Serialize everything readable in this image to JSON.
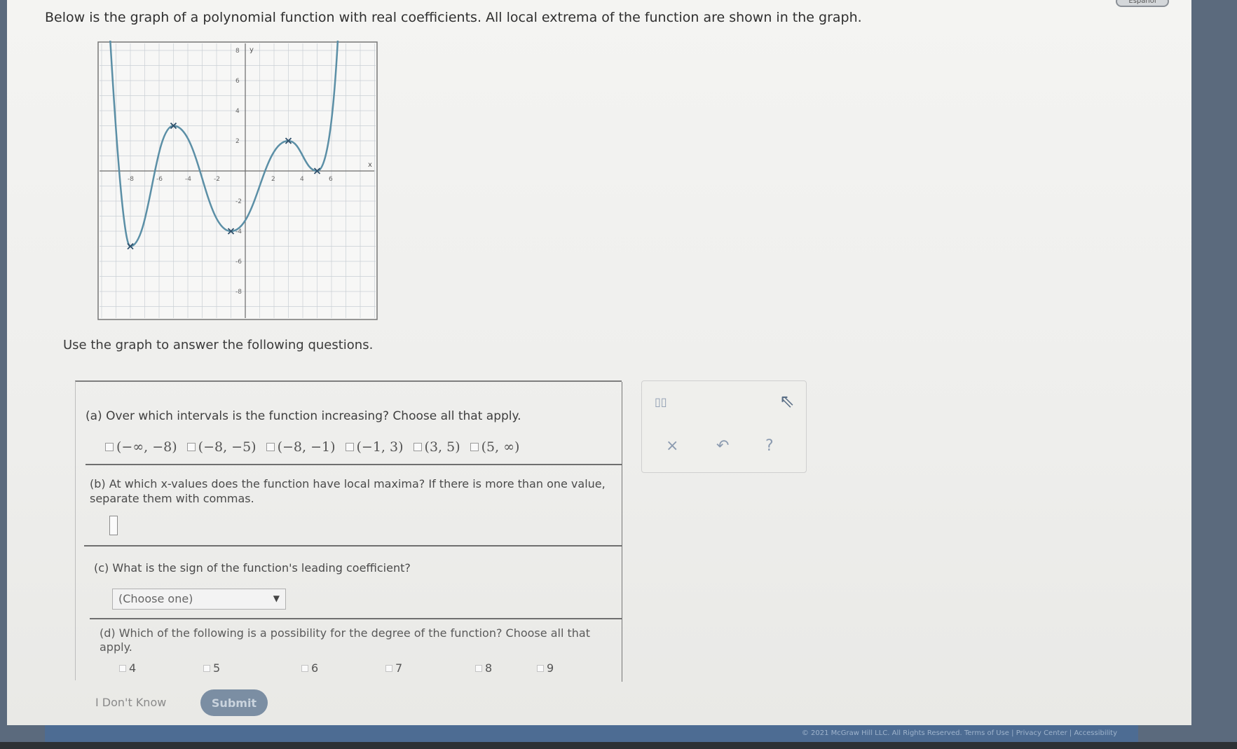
{
  "header": {
    "language_button": "Español",
    "intro": "Below is the graph of a polynomial function with real coefficients. All local extrema of the function are shown in the graph."
  },
  "graph": {
    "x_axis_label": "x",
    "y_axis_label": "y",
    "x_ticks": [
      "-8",
      "-6",
      "-4",
      "-2",
      "2",
      "4",
      "6"
    ],
    "y_ticks": [
      "8",
      "6",
      "4",
      "2",
      "-2",
      "-4",
      "-6",
      "-8"
    ],
    "extrema": [
      {
        "x": -8,
        "y": -5
      },
      {
        "x": -5,
        "y": 3
      },
      {
        "x": -1,
        "y": -4
      },
      {
        "x": 3,
        "y": 2
      },
      {
        "x": 5,
        "y": 0
      }
    ],
    "curve_color": "#5b8fa6",
    "grid_color": "#c9cfd4"
  },
  "instructions": "Use the graph to answer the following questions.",
  "questions": {
    "a": {
      "prompt": "(a) Over which intervals is the function increasing? Choose all that apply.",
      "options": [
        "(−∞, −8)",
        "(−8, −5)",
        "(−8, −1)",
        "(−1, 3)",
        "(3, 5)",
        "(5, ∞)"
      ]
    },
    "b": {
      "prompt": "(b) At which x-values does the function have local maxima? If there is more than one value, separate them with commas.",
      "answer": ""
    },
    "c": {
      "prompt": "(c) What is the sign of the function's leading coefficient?",
      "selected": "(Choose one)"
    },
    "d": {
      "prompt": "(d) Which of the following is a possibility for the degree of the function? Choose all that apply.",
      "options": [
        "4",
        "5",
        "6",
        "7",
        "8",
        "9"
      ]
    }
  },
  "tools": {
    "fraction_icon": "▯▯",
    "clear_icon": "×",
    "undo_icon": "↶",
    "help_icon": "?"
  },
  "actions": {
    "dont_know": "I Don't Know",
    "submit": "Submit"
  },
  "footer": {
    "text": "© 2021 McGraw Hill LLC. All Rights Reserved.   Terms of Use  |  Privacy Center  |  Accessibility"
  }
}
